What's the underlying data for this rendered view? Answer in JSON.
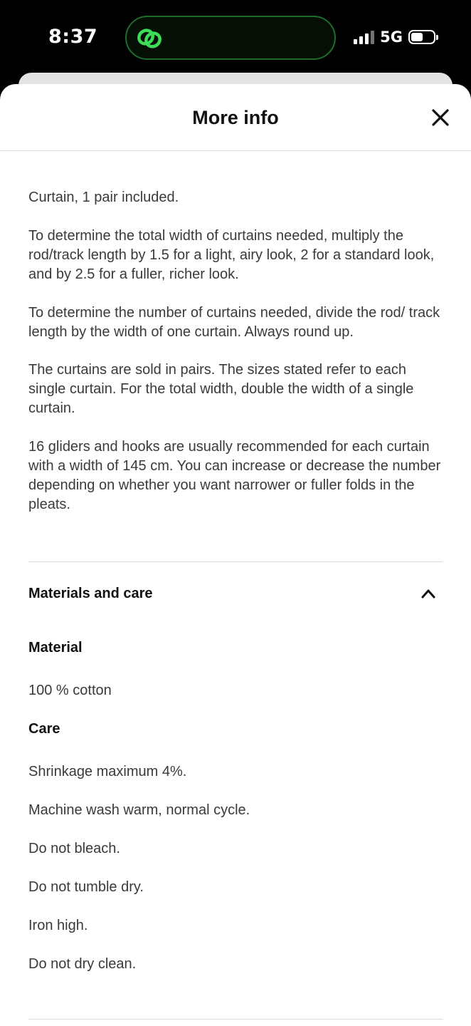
{
  "status_bar": {
    "time": "8:37",
    "network": "5G",
    "island_icon": "linked-rings-icon",
    "signal_icon": "cellular-signal-icon",
    "battery_icon": "battery-icon"
  },
  "sheet": {
    "title": "More info",
    "close_icon": "close-icon"
  },
  "description": {
    "paragraphs": [
      "Curtain, 1 pair included.",
      "To determine the total width of curtains needed, multiply the rod/track length by 1.5 for a light, airy look, 2 for a standard look, and by 2.5 for a fuller, richer look.",
      "To determine the number of curtains needed, divide the rod/ track length by the width of one curtain. Always round up.",
      "The curtains are sold in pairs. The sizes stated refer to each single curtain. For the total width, double the width of a single curtain.",
      "16 gliders and hooks are usually recommended for each curtain with a width of 145 cm. You can increase or decrease the number depending on whether you want narrower or fuller folds in the pleats."
    ]
  },
  "materials_and_care": {
    "title": "Materials and care",
    "expanded": true,
    "toggle_icon": "chevron-up-icon",
    "material_heading": "Material",
    "material_value": "100 % cotton",
    "care_heading": "Care",
    "care_items": [
      "Shrinkage maximum 4%.",
      "Machine wash warm, normal cycle.",
      "Do not bleach.",
      "Do not tumble dry.",
      "Iron high.",
      "Do not dry clean."
    ]
  },
  "colors": {
    "background": "#000000",
    "sheet": "#ffffff",
    "text_primary": "#111111",
    "text_body": "#3a3a3a",
    "divider": "#dddddd",
    "island_accent": "#3ddc57"
  }
}
